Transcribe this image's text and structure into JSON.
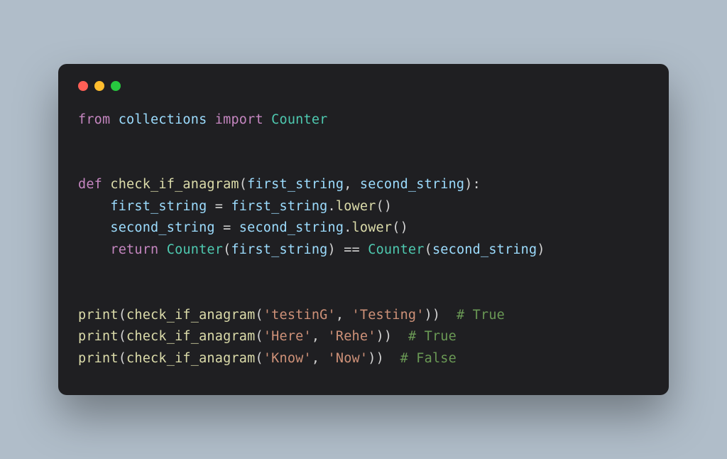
{
  "window": {
    "dots": [
      "red",
      "yellow",
      "green"
    ]
  },
  "code": {
    "line1": {
      "from": "from",
      "module": "collections",
      "import": "import",
      "name": "Counter"
    },
    "line2": "",
    "line3": "",
    "line4": {
      "def": "def",
      "fn": "check_if_anagram",
      "p1": "first_string",
      "p2": "second_string"
    },
    "line5": {
      "indent": "    ",
      "lhs": "first_string",
      "eq": "=",
      "rhs": "first_string",
      "dot": ".",
      "m": "lower"
    },
    "line6": {
      "indent": "    ",
      "lhs": "second_string",
      "eq": "=",
      "rhs": "second_string",
      "dot": ".",
      "m": "lower"
    },
    "line7": {
      "indent": "    ",
      "ret": "return",
      "cls1": "Counter",
      "a1": "first_string",
      "op": "==",
      "cls2": "Counter",
      "a2": "second_string"
    },
    "line8": "",
    "line9": "",
    "line10": {
      "print": "print",
      "fn": "check_if_anagram",
      "s1": "'testinG'",
      "s2": "'Testing'",
      "cmt": "# True"
    },
    "line11": {
      "print": "print",
      "fn": "check_if_anagram",
      "s1": "'Here'",
      "s2": "'Rehe'",
      "cmt": "# True"
    },
    "line12": {
      "print": "print",
      "fn": "check_if_anagram",
      "s1": "'Know'",
      "s2": "'Now'",
      "cmt": "# False"
    }
  }
}
